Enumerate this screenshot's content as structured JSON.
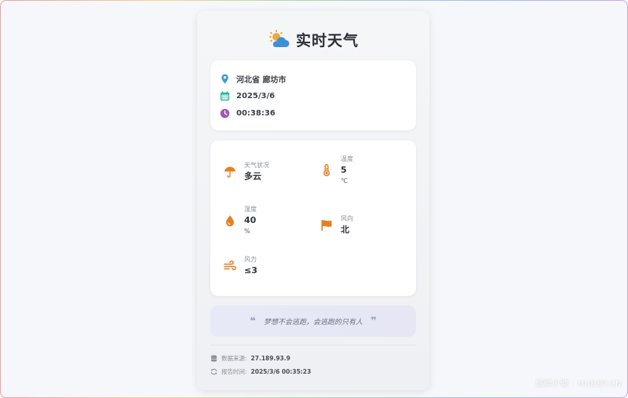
{
  "app": {
    "title": "实时天气"
  },
  "location": {
    "text": "河北省 廊坊市",
    "date": "2025/3/6",
    "time": "00:38:36"
  },
  "weather": {
    "condition": {
      "label": "天气状况",
      "value": "多云"
    },
    "temperature": {
      "label": "温度",
      "value": "5",
      "unit": "℃"
    },
    "humidity": {
      "label": "湿度",
      "value": "40",
      "unit": "%"
    },
    "wind_direction": {
      "label": "风向",
      "value": "北"
    },
    "wind_power": {
      "label": "风力",
      "value": "≤3"
    }
  },
  "quote": {
    "open": "❝",
    "text": "梦想不会逃跑，会逃跑的只有人",
    "close": "❞"
  },
  "footer": {
    "source_label": "数据来源:",
    "source_value": "27.189.93.9",
    "report_label": "报告时间:",
    "report_value": "2025/3/6 00:35:23"
  },
  "watermark": "頭條小號 · MUDDY.CN",
  "icons": {
    "title": "cloud-sun-icon",
    "location": "map-pin-icon",
    "date": "calendar-icon",
    "time": "clock-icon",
    "condition": "umbrella-icon",
    "temperature": "thermometer-icon",
    "humidity": "droplet-icon",
    "wind_direction": "flag-icon",
    "wind_power": "wind-icon",
    "source": "database-icon",
    "report": "sync-icon"
  },
  "colors": {
    "accent_blue": "#3f8fd8",
    "location_blue": "#3b9ad9",
    "calendar_green": "#2bb59a",
    "clock_purple": "#9b59b6",
    "weather_orange": "#e67e22"
  }
}
